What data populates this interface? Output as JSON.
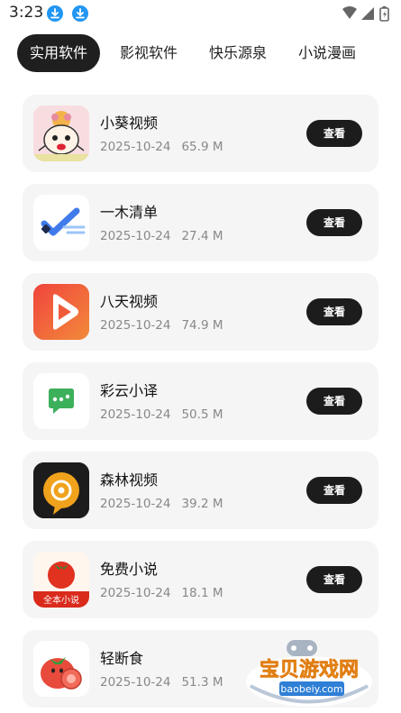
{
  "status_bar": {
    "time": "3:23"
  },
  "tabs": [
    {
      "label": "实用软件",
      "active": true
    },
    {
      "label": "影视软件",
      "active": false
    },
    {
      "label": "快乐源泉",
      "active": false
    },
    {
      "label": "小说漫画",
      "active": false
    }
  ],
  "view_label": "查看",
  "apps": [
    {
      "name": "小葵视频",
      "date": "2025-10-24",
      "size": "65.9 M",
      "icon": "cartoon-girl-icon"
    },
    {
      "name": "一木清单",
      "date": "2025-10-24",
      "size": "27.4 M",
      "icon": "checkmark-icon"
    },
    {
      "name": "八天视频",
      "date": "2025-10-24",
      "size": "74.9 M",
      "icon": "play-icon"
    },
    {
      "name": "彩云小译",
      "date": "2025-10-24",
      "size": "50.5 M",
      "icon": "chat-bubble-icon"
    },
    {
      "name": "森林视频",
      "date": "2025-10-24",
      "size": "39.2 M",
      "icon": "lens-icon"
    },
    {
      "name": "免费小说",
      "date": "2025-10-24",
      "size": "18.1 M",
      "icon": "tomato-book-icon"
    },
    {
      "name": "轻断食",
      "date": "2025-10-24",
      "size": "51.3 M",
      "icon": "tomato-icon"
    }
  ],
  "tomato_book_label": "全本小说",
  "watermark": {
    "title": "宝贝游戏网",
    "url": "baobeiy.com"
  }
}
